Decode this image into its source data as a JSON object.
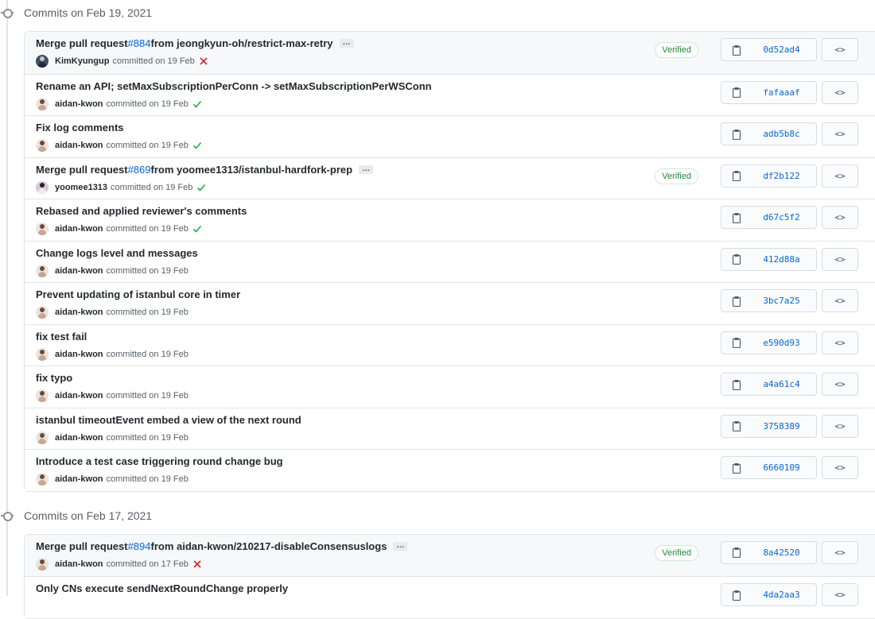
{
  "groups": [
    {
      "date_label": "Commits on Feb 19, 2021",
      "commits": [
        {
          "title": "Merge pull request ",
          "pr": "#884",
          "title_rest": " from jeongkyun-oh/restrict-max-retry",
          "ellipsis": "…",
          "author": "KimKyungup",
          "committed": "committed on 19 Feb",
          "status": "fail",
          "verified": "Verified",
          "sha": "0d52ad4",
          "avatar": "dark",
          "highlight": true
        },
        {
          "title": "Rename an API; setMaxSubscriptionPerConn -> setMaxSubscriptionPerWSConn",
          "author": "aidan-kwon",
          "committed": "committed on 19 Feb",
          "status": "success",
          "sha": "fafaaaf",
          "avatar": "default"
        },
        {
          "title": "Fix log comments",
          "author": "aidan-kwon",
          "committed": "committed on 19 Feb",
          "status": "success",
          "sha": "adb5b8c",
          "avatar": "default"
        },
        {
          "title": "Merge pull request ",
          "pr": "#869",
          "title_rest": " from yoomee1313/istanbul-hardfork-prep",
          "ellipsis": "…",
          "author": "yoomee1313",
          "committed": "committed on 19 Feb",
          "status": "success",
          "verified": "Verified",
          "sha": "df2b122",
          "avatar": "light"
        },
        {
          "title": "Rebased and applied reviewer's comments",
          "author": "aidan-kwon",
          "committed": "committed on 19 Feb",
          "status": "success",
          "sha": "d67c5f2",
          "avatar": "default"
        },
        {
          "title": "Change logs level and messages",
          "author": "aidan-kwon",
          "committed": "committed on 19 Feb",
          "status": "none",
          "sha": "412d88a",
          "avatar": "default"
        },
        {
          "title": "Prevent updating of istanbul core in timer",
          "author": "aidan-kwon",
          "committed": "committed on 19 Feb",
          "status": "none",
          "sha": "3bc7a25",
          "avatar": "default"
        },
        {
          "title": "fix test fail",
          "author": "aidan-kwon",
          "committed": "committed on 19 Feb",
          "status": "none",
          "sha": "e590d93",
          "avatar": "default"
        },
        {
          "title": "fix typo",
          "author": "aidan-kwon",
          "committed": "committed on 19 Feb",
          "status": "none",
          "sha": "a4a61c4",
          "avatar": "default"
        },
        {
          "title": "istanbul timeoutEvent embed a view of the next round",
          "author": "aidan-kwon",
          "committed": "committed on 19 Feb",
          "status": "none",
          "sha": "3758389",
          "avatar": "default"
        },
        {
          "title": "Introduce a test case triggering round change bug",
          "author": "aidan-kwon",
          "committed": "committed on 19 Feb",
          "status": "none",
          "sha": "6660109",
          "avatar": "default"
        }
      ]
    },
    {
      "date_label": "Commits on Feb 17, 2021",
      "commits": [
        {
          "title": "Merge pull request ",
          "pr": "#894",
          "title_rest": " from aidan-kwon/210217-disableConsensuslogs",
          "ellipsis": "…",
          "author": "aidan-kwon",
          "committed": "committed on 17 Feb",
          "status": "fail",
          "verified": "Verified",
          "sha": "8a42520",
          "avatar": "default",
          "highlight": true
        },
        {
          "title": "Only CNs execute sendNextRoundChange properly",
          "author": "",
          "committed": "",
          "status": "none",
          "sha": "4da2aa3",
          "avatar": "none"
        }
      ]
    }
  ],
  "browse_label": "<>",
  "icons": {
    "copy": "clipboard-icon",
    "check": "check-icon",
    "x": "x-icon",
    "commit": "git-commit-icon"
  },
  "colors": {
    "link": "#0366d6",
    "success": "#28a745",
    "fail": "#cb2431",
    "verified": "#22863a"
  }
}
